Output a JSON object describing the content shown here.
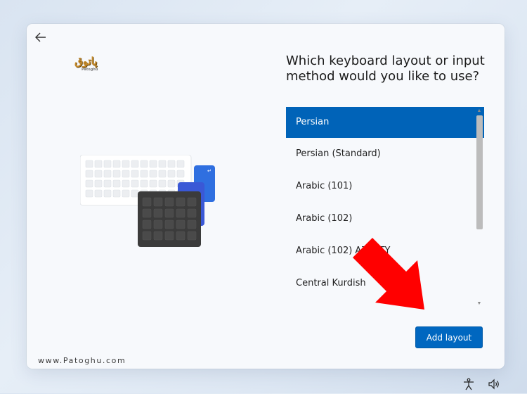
{
  "header": {
    "back_icon": "back-arrow-icon"
  },
  "logo": {
    "text": "پاتوق",
    "subtext": "Patoghu"
  },
  "title": "Which keyboard layout or input method would you like to use?",
  "layouts": [
    {
      "label": "Persian",
      "selected": true
    },
    {
      "label": "Persian (Standard)",
      "selected": false
    },
    {
      "label": "Arabic (101)",
      "selected": false
    },
    {
      "label": "Arabic (102)",
      "selected": false
    },
    {
      "label": "Arabic (102) AZERTY",
      "selected": false
    },
    {
      "label": "Central Kurdish",
      "selected": false
    }
  ],
  "add_button": "Add layout",
  "watermark": "www.Patoghu.com",
  "taskbar": {
    "icons": [
      "accessibility-icon",
      "volume-icon"
    ]
  },
  "colors": {
    "accent": "#0063b8",
    "annotation_arrow": "#ff0000"
  }
}
